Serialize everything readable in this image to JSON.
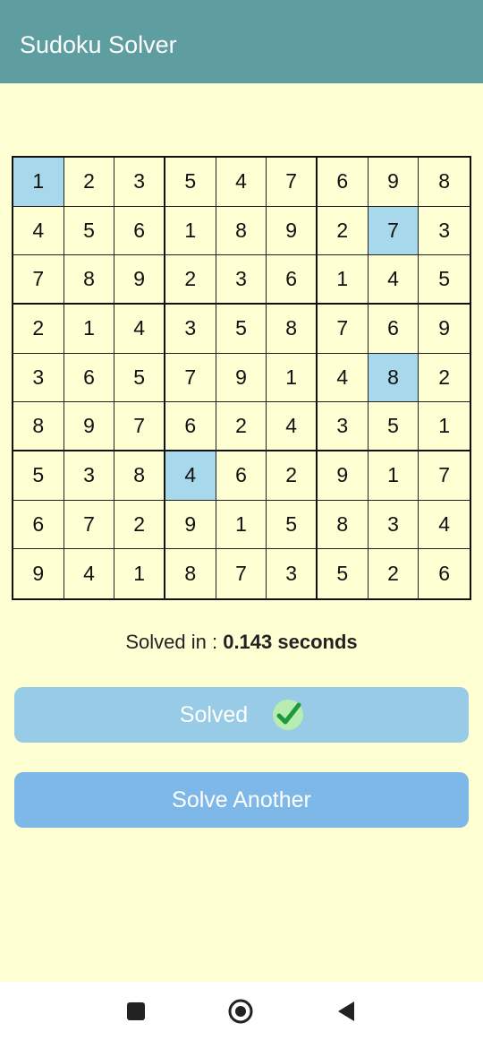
{
  "app_bar": {
    "title": "Sudoku Solver",
    "color": "#5f9ea0"
  },
  "board": {
    "rows": [
      [
        "1",
        "2",
        "3",
        "5",
        "4",
        "7",
        "6",
        "9",
        "8"
      ],
      [
        "4",
        "5",
        "6",
        "1",
        "8",
        "9",
        "2",
        "7",
        "3"
      ],
      [
        "7",
        "8",
        "9",
        "2",
        "3",
        "6",
        "1",
        "4",
        "5"
      ],
      [
        "2",
        "1",
        "4",
        "3",
        "5",
        "8",
        "7",
        "6",
        "9"
      ],
      [
        "3",
        "6",
        "5",
        "7",
        "9",
        "1",
        "4",
        "8",
        "2"
      ],
      [
        "8",
        "9",
        "7",
        "6",
        "2",
        "4",
        "3",
        "5",
        "1"
      ],
      [
        "5",
        "3",
        "8",
        "4",
        "6",
        "2",
        "9",
        "1",
        "7"
      ],
      [
        "6",
        "7",
        "2",
        "9",
        "1",
        "5",
        "8",
        "3",
        "4"
      ],
      [
        "9",
        "4",
        "1",
        "8",
        "7",
        "3",
        "5",
        "2",
        "6"
      ]
    ],
    "highlighted_cells": [
      [
        0,
        0
      ],
      [
        1,
        7
      ],
      [
        4,
        7
      ],
      [
        6,
        3
      ]
    ],
    "highlight_color": "#a7d8ec"
  },
  "status": {
    "prefix": "Solved in : ",
    "time": "0.143 seconds"
  },
  "buttons": {
    "solved_label": "Solved",
    "solve_another_label": "Solve Another"
  },
  "icons": {
    "solved": "check-icon",
    "nav": [
      "square-stop-icon",
      "home-circle-icon",
      "back-triangle-icon"
    ]
  },
  "colors": {
    "background": "#ffffd4",
    "button_solved": "#97cbe6",
    "button_another": "#7db8e8"
  }
}
